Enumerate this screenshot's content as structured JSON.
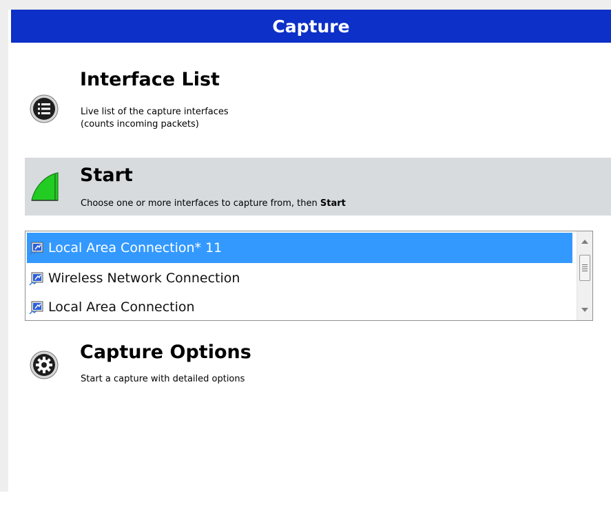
{
  "header": {
    "title": "Capture"
  },
  "interface_list": {
    "title": "Interface List",
    "desc_line1": "Live list of the capture interfaces",
    "desc_line2": "(counts incoming packets)",
    "icon": "list-icon"
  },
  "start": {
    "title": "Start",
    "desc_prefix": "Choose one or more interfaces to capture from, then ",
    "desc_bold": "Start",
    "icon": "shark-fin-icon"
  },
  "interfaces": {
    "items": [
      {
        "label": "Local Area Connection* 11",
        "selected": true
      },
      {
        "label": "Wireless Network Connection",
        "selected": false
      },
      {
        "label": "Local Area Connection",
        "selected": false
      }
    ],
    "icon": "network-adapter-icon",
    "selection_color": "#3399ff"
  },
  "capture_options": {
    "title": "Capture Options",
    "desc": "Start a capture with detailed options",
    "icon": "gear-icon"
  },
  "colors": {
    "header_bg": "#0d30c8",
    "start_bg": "#d7dbde",
    "start_icon": "#22cc22"
  }
}
